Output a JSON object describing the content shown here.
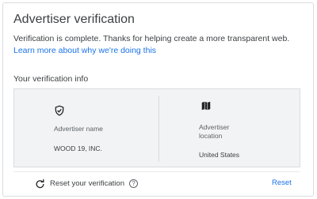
{
  "header": {
    "title": "Advertiser verification"
  },
  "description": {
    "text": "Verification is complete. Thanks for helping create a more transparent web.",
    "learn_more": "Learn more about why we're doing this"
  },
  "verification_info": {
    "section_title": "Your verification info",
    "left": {
      "icon": "shield-check-icon",
      "label": "Advertiser name",
      "value": "WOOD 19, INC."
    },
    "right": {
      "icon": "map-icon",
      "label_line1": "Advertiser",
      "label_line2": "location",
      "value": "United States"
    }
  },
  "footer": {
    "reset_verification_label": "Reset your verification",
    "help_icon": "help-icon",
    "reset_label": "Reset"
  }
}
